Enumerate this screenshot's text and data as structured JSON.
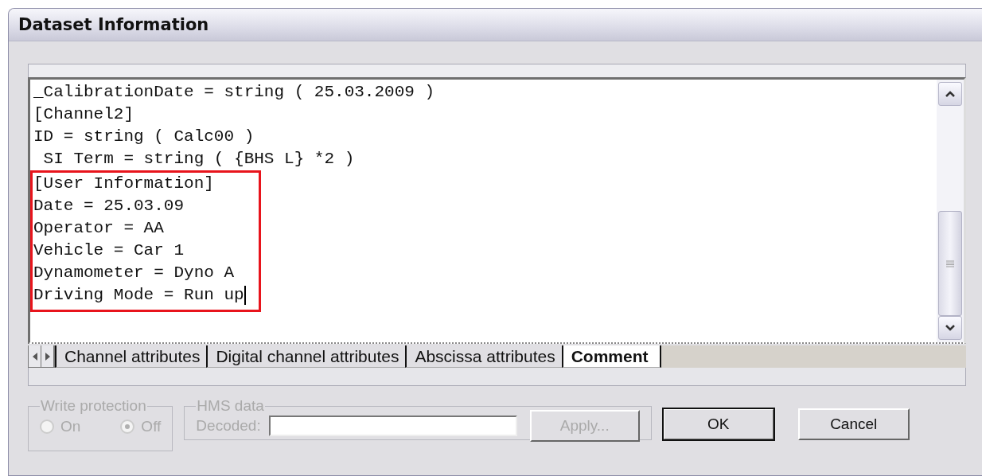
{
  "window": {
    "title": "Dataset Information"
  },
  "editor": {
    "lines": [
      "_CalibrationDate = string ( 25.03.2009 )",
      "[Channel2]",
      "ID = string ( Calc00 )",
      " SI Term = string ( {BHS L} *2 )"
    ],
    "framed_block": {
      "lines": [
        "[User Information]",
        "Date = 25.03.09",
        "Operator = AA",
        "Vehicle = Car 1",
        "Dynamometer = Dyno A",
        "Driving Mode = Run up"
      ],
      "caret_at_end": true
    }
  },
  "tabs": [
    {
      "label": "Channel attributes",
      "selected": false
    },
    {
      "label": "Digital channel attributes",
      "selected": false
    },
    {
      "label": "Abscissa attributes",
      "selected": false
    },
    {
      "label": "Comment",
      "selected": true
    }
  ],
  "write_protection": {
    "title": "Write protection",
    "disabled": true,
    "options": [
      {
        "label": "On",
        "selected": false
      },
      {
        "label": "Off",
        "selected": true
      }
    ]
  },
  "hms_data": {
    "title": "HMS data",
    "field_label": "Decoded:",
    "apply": {
      "label": "Apply...",
      "disabled": true
    }
  },
  "buttons": [
    {
      "label": "OK",
      "default": true
    },
    {
      "label": "Cancel",
      "default": false
    }
  ]
}
